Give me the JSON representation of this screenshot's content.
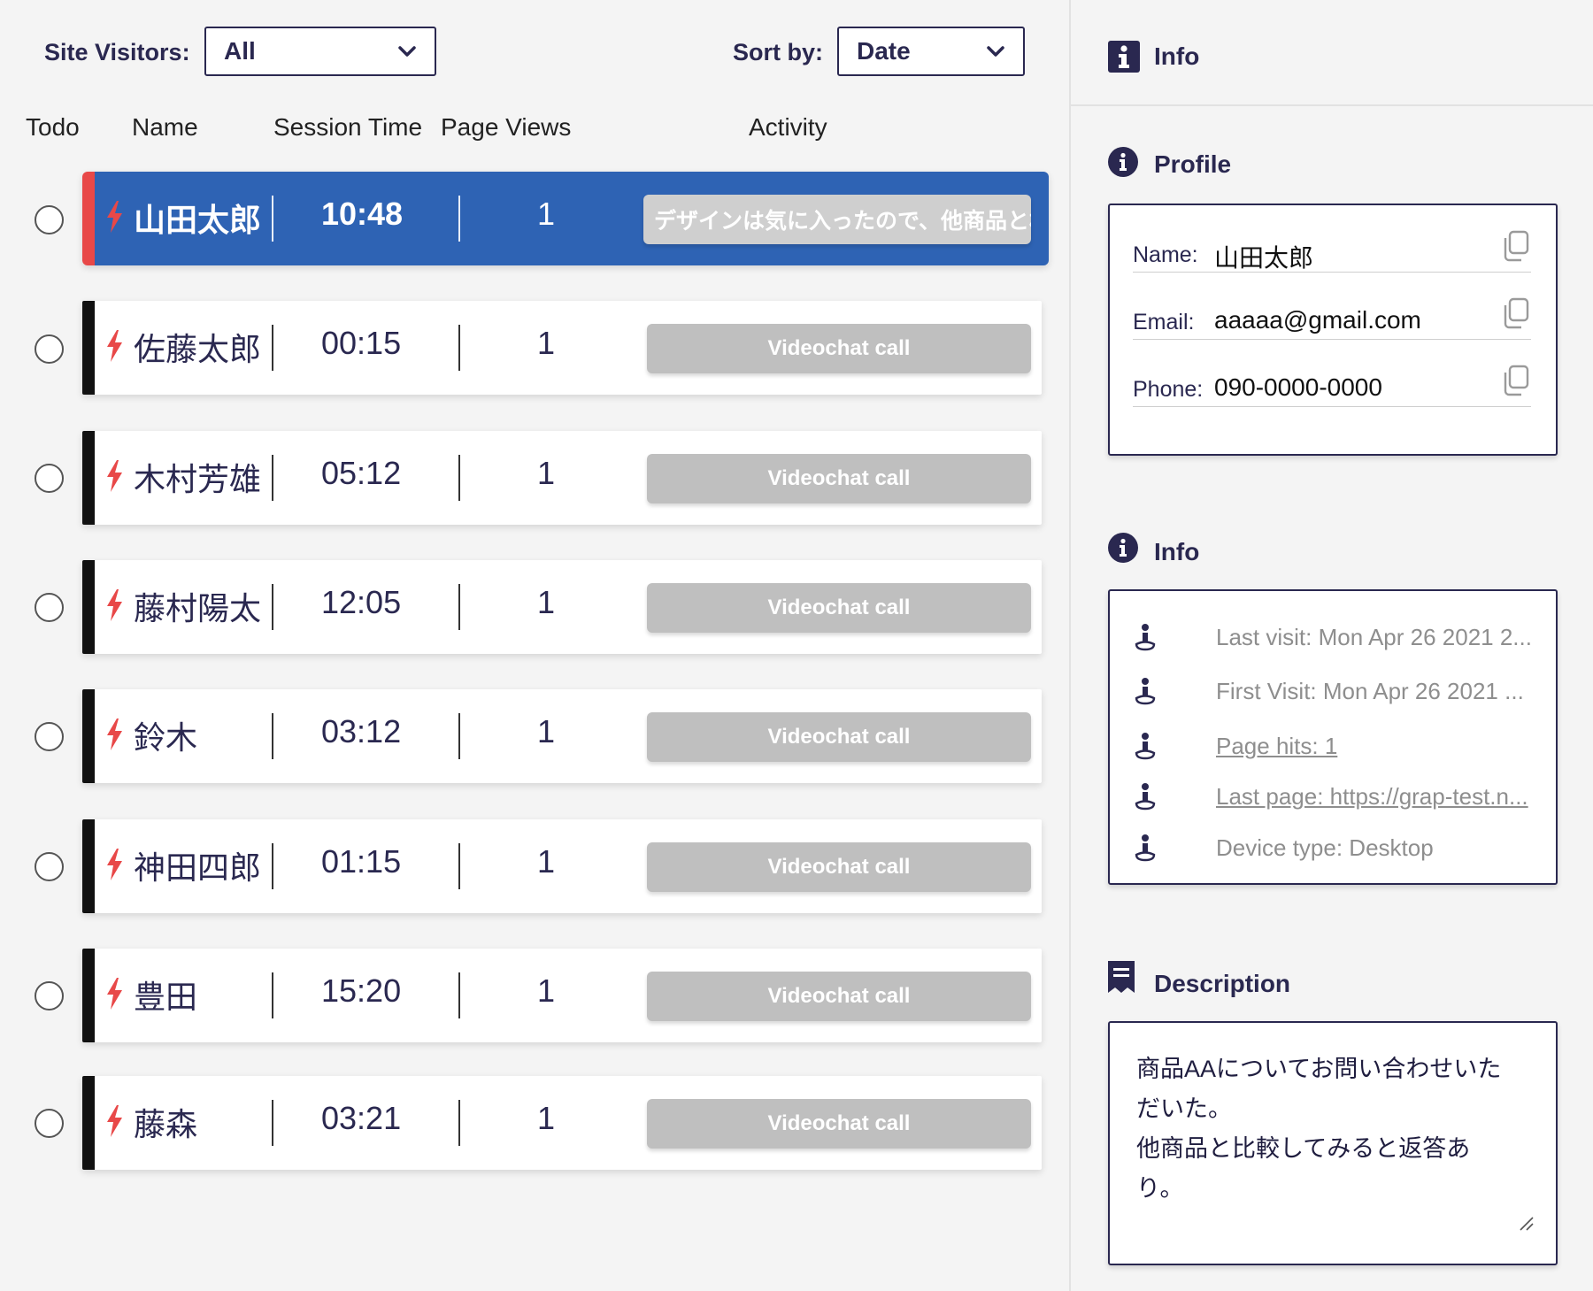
{
  "filters": {
    "visitors_label": "Site Visitors:",
    "visitors_value": "All",
    "sort_label": "Sort by:",
    "sort_value": "Date"
  },
  "columns": [
    "Todo",
    "Name",
    "Session Time",
    "Page Views",
    "Activity"
  ],
  "visitors": [
    {
      "name": "山田太郎",
      "session_time": "10:48",
      "page_views": "1",
      "activity": "デザインは気に入ったので、他商品と検討"
    },
    {
      "name": "佐藤太郎",
      "session_time": "00:15",
      "page_views": "1",
      "activity": "Videochat call"
    },
    {
      "name": "木村芳雄",
      "session_time": "05:12",
      "page_views": "1",
      "activity": "Videochat call"
    },
    {
      "name": "藤村陽太",
      "session_time": "12:05",
      "page_views": "1",
      "activity": "Videochat call"
    },
    {
      "name": "鈴木",
      "session_time": "03:12",
      "page_views": "1",
      "activity": "Videochat call"
    },
    {
      "name": "神田四郎",
      "session_time": "01:15",
      "page_views": "1",
      "activity": "Videochat call"
    },
    {
      "name": "豊田",
      "session_time": "15:20",
      "page_views": "1",
      "activity": "Videochat call"
    },
    {
      "name": "藤森",
      "session_time": "03:21",
      "page_views": "1",
      "activity": "Videochat call"
    }
  ],
  "panel": {
    "header_title": "Info",
    "profile": {
      "title": "Profile",
      "name_label": "Name:",
      "name_value": "山田太郎",
      "email_label": "Email:",
      "email_value": "aaaaa@gmail.com",
      "phone_label": "Phone:",
      "phone_value": "090-0000-0000"
    },
    "info": {
      "title": "Info",
      "items": [
        "Last visit: Mon Apr 26 2021 2...",
        "First Visit: Mon Apr 26 2021 ...",
        "Page hits: 1",
        "Last page: https://grap-test.n...",
        "Device type: Desktop"
      ]
    },
    "description": {
      "title": "Description",
      "lines": [
        "商品AAについてお問い合わせいた",
        "だいた。",
        "他商品と比較してみると返答あ",
        "り。"
      ]
    }
  },
  "colors": {
    "accent": "#2e63b4",
    "navy": "#2a2850",
    "bolt": "#e84848",
    "button_gray": "#bfbfbf"
  }
}
